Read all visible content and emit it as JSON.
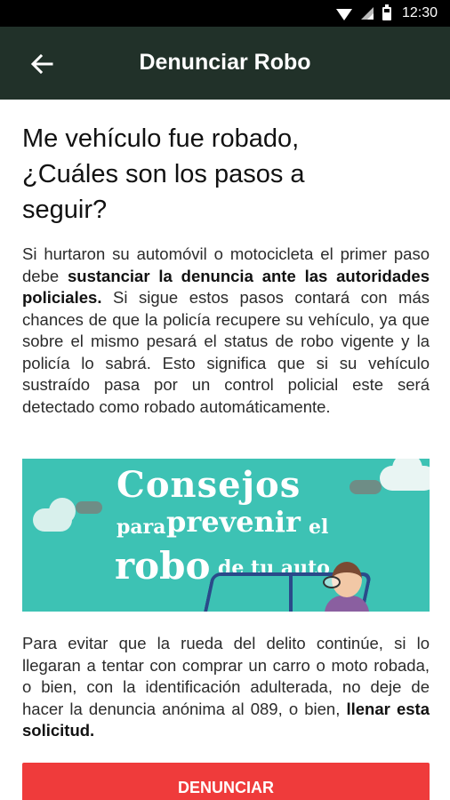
{
  "status_bar": {
    "time": "12:30"
  },
  "app_bar": {
    "title": "Denunciar Robo"
  },
  "content": {
    "heading": "Me vehículo fue robado, ¿Cuáles son los pasos a seguir?",
    "para1": {
      "text_a": "Si hurtaron su automóvil o motocicleta el primer paso debe ",
      "bold_a": "sustanciar la denuncia ante las autoridades policiales.",
      "text_b": " Si sigue estos pasos contará con más chances de que la policía recupere su vehículo, ya que sobre el mismo pesará el status de robo vigente y la policía lo sabrá. Esto significa que si su vehículo sustraído pasa por un control policial este será detectado como robado automáticamente."
    },
    "banner": {
      "line1": "Consejos",
      "line2_a": "para",
      "line2_b": "prevenir",
      "line2_c": "el",
      "line3_a": "robo",
      "line3_b": "de tu auto"
    },
    "para2": {
      "text_a": "Para evitar que la rueda del delito continúe, si lo llegaran a tentar con comprar un carro o moto robada, o bien, con la identificación adulterada, no deje de hacer la denuncia anónima al 089, o bien, ",
      "bold_a": "llenar esta solicitud."
    },
    "cta_label": "DENUNCIAR"
  },
  "colors": {
    "app_bar": "#213129",
    "banner": "#3dc2b4",
    "cta": "#ef3b3b"
  }
}
